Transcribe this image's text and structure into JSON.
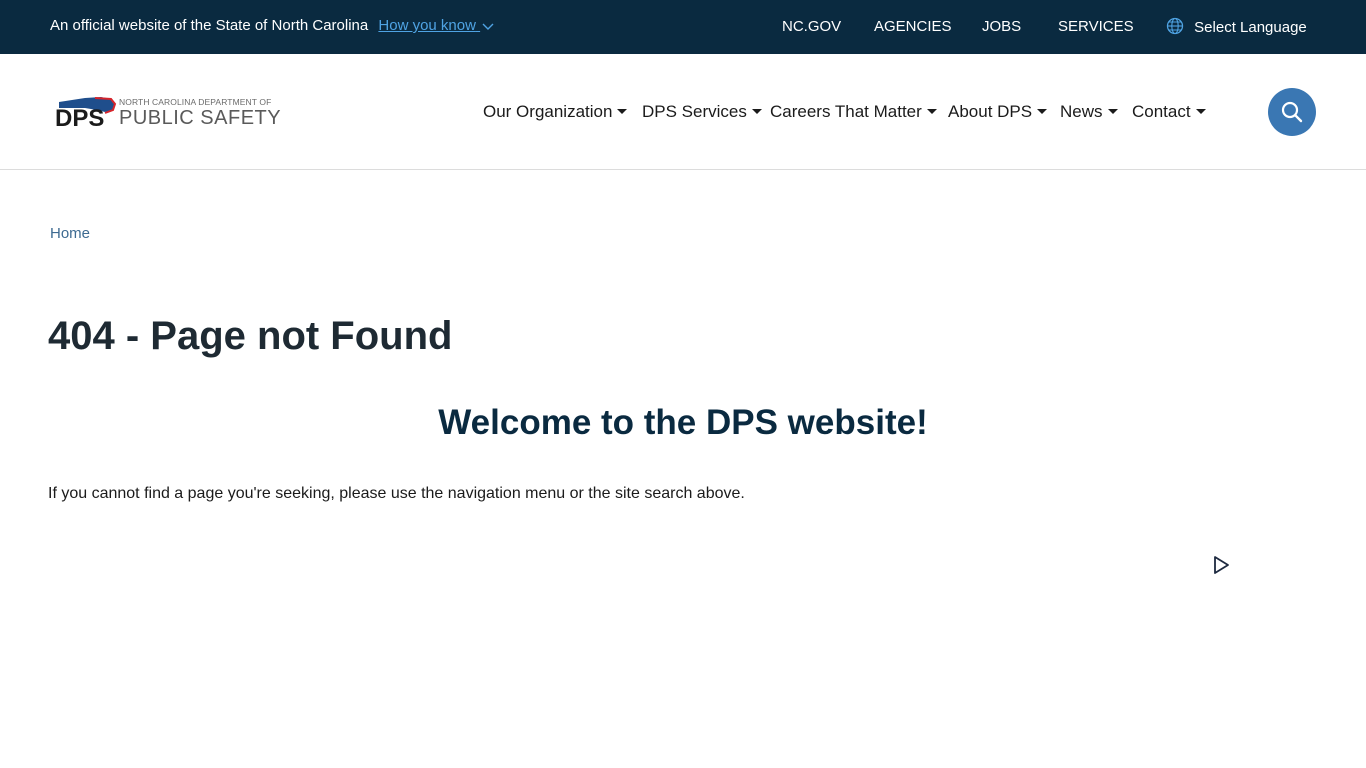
{
  "topbar": {
    "official_text": "An official website of the State of North Carolina",
    "how_you_know": "How you know",
    "links": [
      "NC.GOV",
      "AGENCIES",
      "JOBS",
      "SERVICES"
    ],
    "language": "Select Language"
  },
  "logo": {
    "top_line": "NORTH CAROLINA DEPARTMENT OF",
    "bottom_line": "PUBLIC SAFETY",
    "mark": "DPS"
  },
  "nav": {
    "items": [
      "Our Organization",
      "DPS Services",
      "Careers That Matter",
      "About DPS",
      "News",
      "Contact"
    ]
  },
  "breadcrumb": {
    "home": "Home"
  },
  "main": {
    "title": "404 - Page not Found",
    "welcome": "Welcome to the DPS website!",
    "body": "If you cannot find a page you're seeking, please use the navigation menu or the site search above."
  },
  "colors": {
    "topbar_bg": "#0a2a40",
    "link_blue": "#4fa3e3",
    "search_bg": "#3a77b3",
    "breadcrumb": "#3d6a91",
    "heading_navy": "#0a2a40"
  },
  "icons": {
    "chevron": "chevron-down-icon",
    "globe": "globe-icon",
    "search": "search-icon",
    "play": "play-icon"
  }
}
